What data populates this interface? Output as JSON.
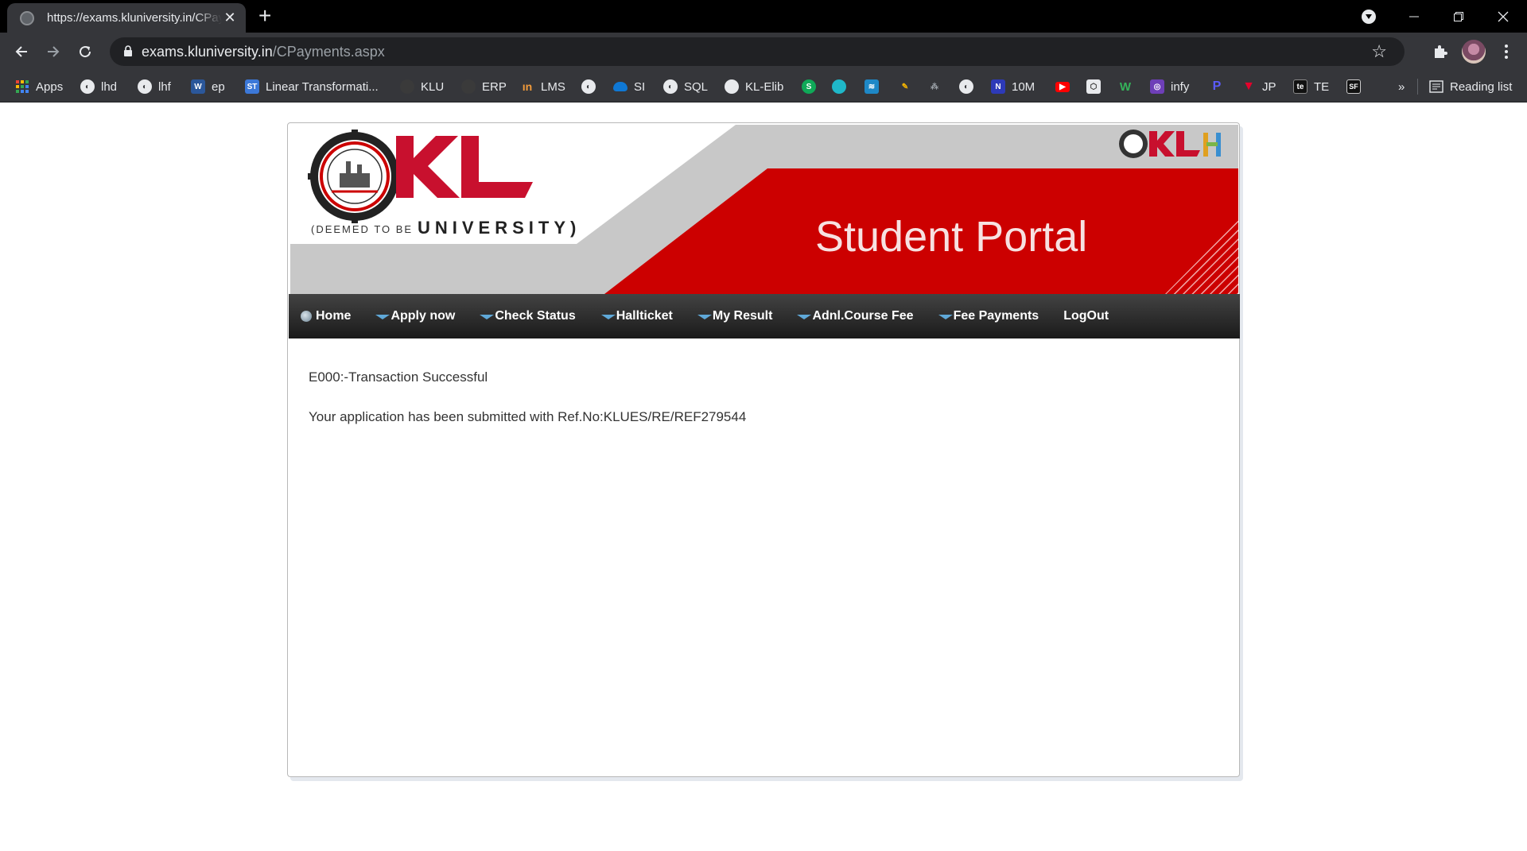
{
  "browser": {
    "tab_title": "https://exams.kluniversity.in/CPayments.aspx",
    "url_host": "exams.kluniversity.in",
    "url_path": "/CPayments.aspx",
    "bookmarks": [
      {
        "label": "Apps",
        "icon": "apps-grid-icon"
      },
      {
        "label": "lhd",
        "icon": "globe-icon"
      },
      {
        "label": "lhf",
        "icon": "globe-icon"
      },
      {
        "label": "ep",
        "icon": "word-icon"
      },
      {
        "label": "Linear Transformati...",
        "icon": "st-icon"
      },
      {
        "label": "KLU",
        "icon": "klu-icon"
      },
      {
        "label": "ERP",
        "icon": "erp-icon"
      },
      {
        "label": "LMS",
        "icon": "lms-icon"
      },
      {
        "label": "SI",
        "icon": "cloud-icon"
      },
      {
        "label": "SQL",
        "icon": "globe-icon"
      },
      {
        "label": "KL-Elib",
        "icon": "elib-icon"
      },
      {
        "label": "10M",
        "icon": "tenm-icon"
      },
      {
        "label": "infy",
        "icon": "infy-icon"
      },
      {
        "label": "JP",
        "icon": "jp-icon"
      },
      {
        "label": "TE",
        "icon": "te-icon"
      }
    ],
    "more_label": "»",
    "reading_list": "Reading list"
  },
  "banner": {
    "deemed": "(DEEMED TO BE",
    "university": "UNIVERSITY)",
    "title": "Student Portal",
    "brand_red": "#cc0000"
  },
  "menu": {
    "items": [
      {
        "label": "Home"
      },
      {
        "label": "Apply now"
      },
      {
        "label": "Check Status"
      },
      {
        "label": "Hallticket"
      },
      {
        "label": "My Result"
      },
      {
        "label": "Adnl.Course Fee"
      },
      {
        "label": "Fee Payments"
      },
      {
        "label": "LogOut"
      }
    ]
  },
  "messages": {
    "status": "E000:-Transaction Successful",
    "submitted": "Your application has been submitted with Ref.No:KLUES/RE/REF279544"
  }
}
